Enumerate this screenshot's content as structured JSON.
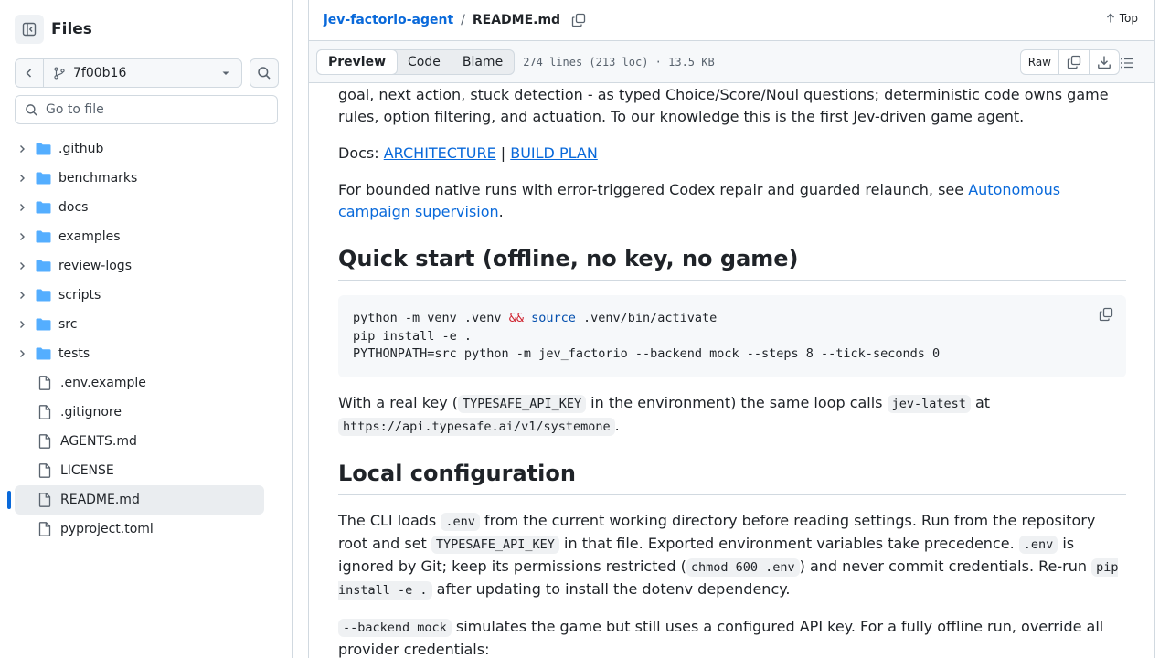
{
  "sidebar": {
    "title": "Files",
    "branch": "7f00b16",
    "goto_placeholder": "Go to file",
    "folders": [
      ".github",
      "benchmarks",
      "docs",
      "examples",
      "review-logs",
      "scripts",
      "src",
      "tests"
    ],
    "files": [
      ".env.example",
      ".gitignore",
      "AGENTS.md",
      "LICENSE",
      "README.md",
      "pyproject.toml"
    ],
    "active_file": "README.md"
  },
  "header": {
    "repo": "jev-factorio-agent",
    "sep": "/",
    "file": "README.md",
    "top_label": "Top"
  },
  "toolbar": {
    "tabs": [
      "Preview",
      "Code",
      "Blame"
    ],
    "active_tab": "Preview",
    "file_info": "274 lines (213 loc) · 13.5 KB",
    "raw_label": "Raw"
  },
  "content": {
    "p0": "goal, next action, stuck detection - as typed Choice/Score/Noul questions; deterministic code owns game rules, option filtering, and actuation. To our knowledge this is the first Jev-driven game agent.",
    "docs_prefix": "Docs: ",
    "docs_link1": "ARCHITECTURE",
    "docs_sep": " | ",
    "docs_link2": "BUILD PLAN",
    "p2_prefix": "For bounded native runs with error-triggered Codex repair and guarded relaunch, see ",
    "p2_link": "Autonomous campaign supervision",
    "p2_suffix": ".",
    "h_quick": "Quick start (offline, no key, no game)",
    "code1_line1_a": "python -m venv .venv ",
    "code1_line1_op": "&&",
    "code1_line1_kw": "source",
    "code1_line1_b": " .venv/bin/activate",
    "code1_line2": "pip install -e .",
    "code1_line3": "PYTHONPATH=src python -m jev_factorio --backend mock --steps 8 --tick-seconds 0",
    "p3_a": "With a real key (",
    "p3_code1": "TYPESAFE_API_KEY",
    "p3_b": " in the environment) the same loop calls ",
    "p3_code2": "jev-latest",
    "p3_c": " at ",
    "p3_code3": "https://api.typesafe.ai/v1/systemone",
    "p3_d": ".",
    "h_local": "Local configuration",
    "p4_a": "The CLI loads ",
    "p4_code1": ".env",
    "p4_b": " from the current working directory before reading settings. Run from the repository root and set ",
    "p4_code2": "TYPESAFE_API_KEY",
    "p4_c": " in that file. Exported environment variables take precedence. ",
    "p4_code3": ".env",
    "p4_d": " is ignored by Git; keep its permissions restricted (",
    "p4_code4": "chmod 600 .env",
    "p4_e": ") and never commit credentials. Re-run ",
    "p4_code5": "pip install -e .",
    "p4_f": " after updating to install the dotenv dependency.",
    "p5_code": "--backend mock",
    "p5_text": " simulates the game but still uses a configured API key. For a fully offline run, override all provider credentials:"
  },
  "colors": {
    "link": "#0969da",
    "accent": "#0969da",
    "border": "#d1d9e0"
  }
}
